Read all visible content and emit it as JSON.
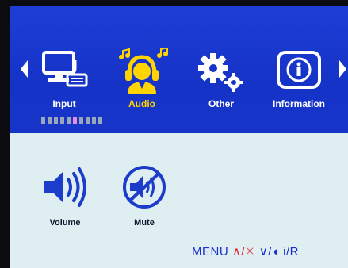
{
  "tabs": [
    {
      "label": "Input",
      "icon": "monitor-keyboard-icon",
      "active": false
    },
    {
      "label": "Audio",
      "icon": "headphones-user-icon",
      "active": true
    },
    {
      "label": "Other",
      "icon": "gears-icon",
      "active": false
    },
    {
      "label": "Information",
      "icon": "info-icon",
      "active": false
    }
  ],
  "items": [
    {
      "label": "Volume",
      "icon": "speaker-volume-icon"
    },
    {
      "label": "Mute",
      "icon": "speaker-mute-icon"
    }
  ],
  "hint": {
    "menu": "MENU",
    "up": "∧/✳",
    "down": "∨/◖",
    "enter": "i/R"
  },
  "colors": {
    "header": "#1734c9",
    "active_label": "#ffd400",
    "page_indicator_active": "#e58be8"
  }
}
